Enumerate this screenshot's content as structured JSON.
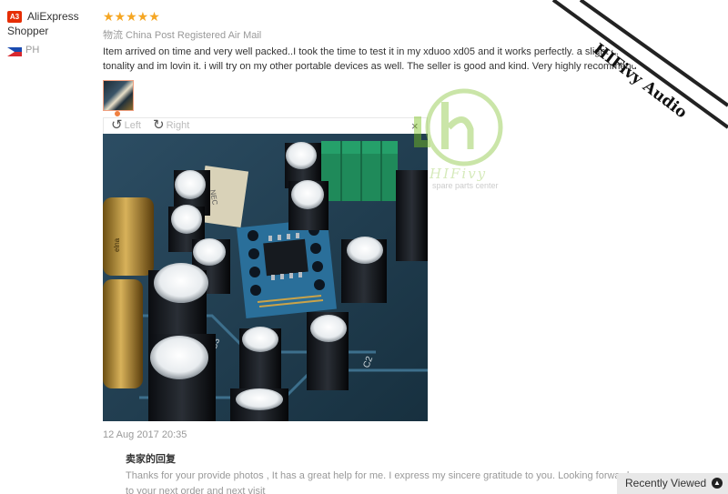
{
  "buyer": {
    "badge": "A3",
    "name_line1": "AliExpress",
    "name_line2": "Shopper",
    "country": "PH"
  },
  "review": {
    "stars": "★★★★★",
    "shipping": "物流 China Post Registered Air Mail",
    "text": "Item arrived on time and very well packed..I took the time to test it in my xduoo xd05 and it works perfectly. a slight change in tonality and im lovin it. i will try on my other portable devices as well. The seller is good and kind. Very highly recommended.",
    "date": "12 Aug 2017 20:35"
  },
  "viewer": {
    "rotate_left": "Left",
    "rotate_right": "Right",
    "close": "×"
  },
  "reply": {
    "title": "卖家的回复",
    "text": "Thanks for your provide photos , It has a great help for me. I express my sincere gratitude to you. Looking forward to your next order and next visit"
  },
  "recently_viewed": "Recently Viewed",
  "watermark": {
    "brand": "HIFivy Audio",
    "logo_text": "HIFivy",
    "logo_sub": "spare parts center"
  },
  "colors": {
    "star": "#f5a623",
    "badge": "#e62e04",
    "watermark_green": "#8cc63f"
  }
}
